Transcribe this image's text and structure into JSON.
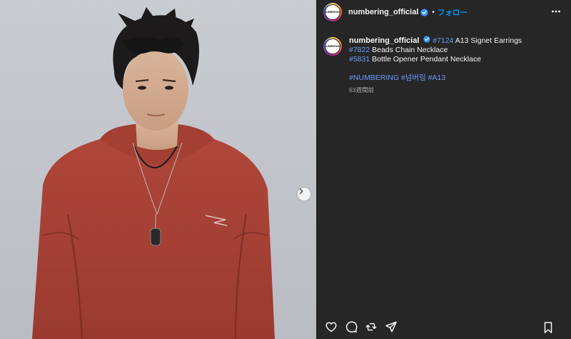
{
  "post": {
    "author": "numbering_official",
    "avatar_text": "NUMBERING",
    "follow_label": "フォロー",
    "caption": {
      "line1_tag": "#7124",
      "line1_text": " A13 Signet Earrings",
      "line2_tag": "#7822",
      "line2_text": " Beads Chain Necklace",
      "line3_tag": "#5831",
      "line3_text": " Bottle Opener Pendant Necklace",
      "hashtags": [
        "#NUMBERING",
        "#넘버링",
        "#A13"
      ]
    },
    "time_ago": "63週間前"
  },
  "icons": {
    "verified": "verified-badge-icon",
    "more": "more-options-icon",
    "next": "chevron-right-icon",
    "like": "heart-icon",
    "comment": "comment-icon",
    "share": "repost-icon",
    "send": "send-icon",
    "save": "bookmark-icon"
  },
  "colors": {
    "panel_bg": "#262626",
    "link": "#6b9bff",
    "follow": "#0095f6",
    "verified": "#3897f0"
  }
}
